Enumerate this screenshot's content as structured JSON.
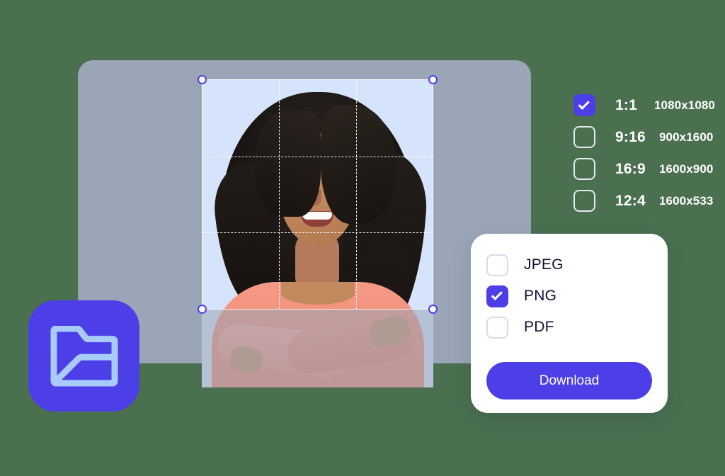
{
  "app": {
    "icon_name": "image-folder-icon",
    "icon_color": "#4c3fe8",
    "icon_glyph_color": "#a9cbfa"
  },
  "canvas": {
    "frame_color": "#9aa6b8",
    "background_color": "#4a7050",
    "photo": {
      "alt": "smiling woman with curly dark hair in a peach sweater, arms crossed",
      "backdrop_color": "#d6e4fb"
    },
    "crop": {
      "handle_fill": "#ffffff",
      "handle_border": "#4c3fe8",
      "grid": "thirds",
      "handles": [
        "top-left",
        "top-right",
        "bottom-left",
        "bottom-right"
      ]
    }
  },
  "ratios": {
    "accent_color": "#4c3fe8",
    "items": [
      {
        "label": "1:1",
        "size": "1080x1080",
        "checked": true
      },
      {
        "label": "9:16",
        "size": "900x1600",
        "checked": false
      },
      {
        "label": "16:9",
        "size": "1600x900",
        "checked": false
      },
      {
        "label": "12:4",
        "size": "1600x533",
        "checked": false
      }
    ]
  },
  "format_panel": {
    "options": [
      {
        "label": "JPEG",
        "checked": false
      },
      {
        "label": "PNG",
        "checked": true
      },
      {
        "label": "PDF",
        "checked": false
      }
    ],
    "download_label": "Download",
    "download_color": "#4c3fe8",
    "text_color": "#141035"
  }
}
